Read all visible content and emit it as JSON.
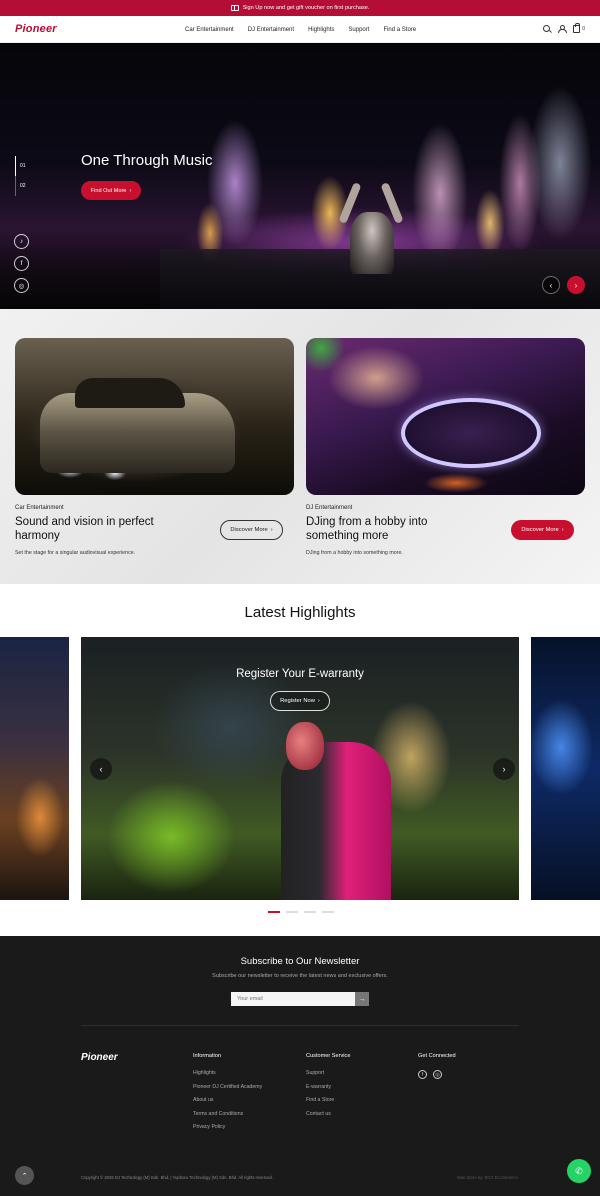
{
  "announcement": {
    "text": "Sign Up now and get gift voucher on first purchase.",
    "icon": "gift-icon"
  },
  "header": {
    "logo": "Pioneer",
    "nav": [
      "Car Entertainment",
      "DJ Entertainment",
      "Highlights",
      "Support",
      "Find a Store"
    ],
    "cart_count": "0"
  },
  "hero": {
    "title": "One Through Music",
    "button": "Find Out More",
    "slides": [
      "01",
      "02"
    ],
    "social": [
      "tiktok-icon",
      "facebook-icon",
      "instagram-icon"
    ]
  },
  "categories": [
    {
      "tag": "Car Entertainment",
      "title": "Sound and vision in perfect harmony",
      "desc": "Set the stage for a singular audiovisual experience.",
      "button": "Discover  More"
    },
    {
      "tag": "DJ Entertainment",
      "title": "DJing from a hobby into something more",
      "desc": "DJing from a hobby into something more.",
      "button": "Discover  More"
    }
  ],
  "highlights": {
    "title": "Latest Highlights",
    "slide_title": "Register Your E-warranty",
    "slide_button": "Register Now",
    "dot_count": 4,
    "active_dot": 1
  },
  "newsletter": {
    "title": "Subscribe to Our Newsletter",
    "subtitle": "Subscribe our newsletter to receive the latest news and exclusive offers.",
    "placeholder": "Your email"
  },
  "footer": {
    "logo": "Pioneer",
    "information": {
      "title": "Information",
      "items": [
        "Highlights",
        "Pioneer DJ Certified Academy",
        "About us",
        "Terms and Conditions",
        "Privacy Policy"
      ]
    },
    "customer_service": {
      "title": "Customer Service",
      "items": [
        "Support",
        "E-warranty",
        "Find a Store",
        "Contact us"
      ]
    },
    "connected": {
      "title": "Get Connected",
      "icons": [
        "facebook-icon",
        "instagram-icon"
      ]
    },
    "copyright": "Copyright © 2026 DJ Technology (M) Sdn. Bhd. | Yuphoru Technology (M) Sdn. Bhd.  All rights reserved.",
    "credit": "Web Store by: EGS ECommerce"
  },
  "colors": {
    "brand_red": "#c8102e",
    "announce": "#b40e37",
    "footer_bg": "#1a1a1a",
    "whatsapp": "#25d366"
  }
}
